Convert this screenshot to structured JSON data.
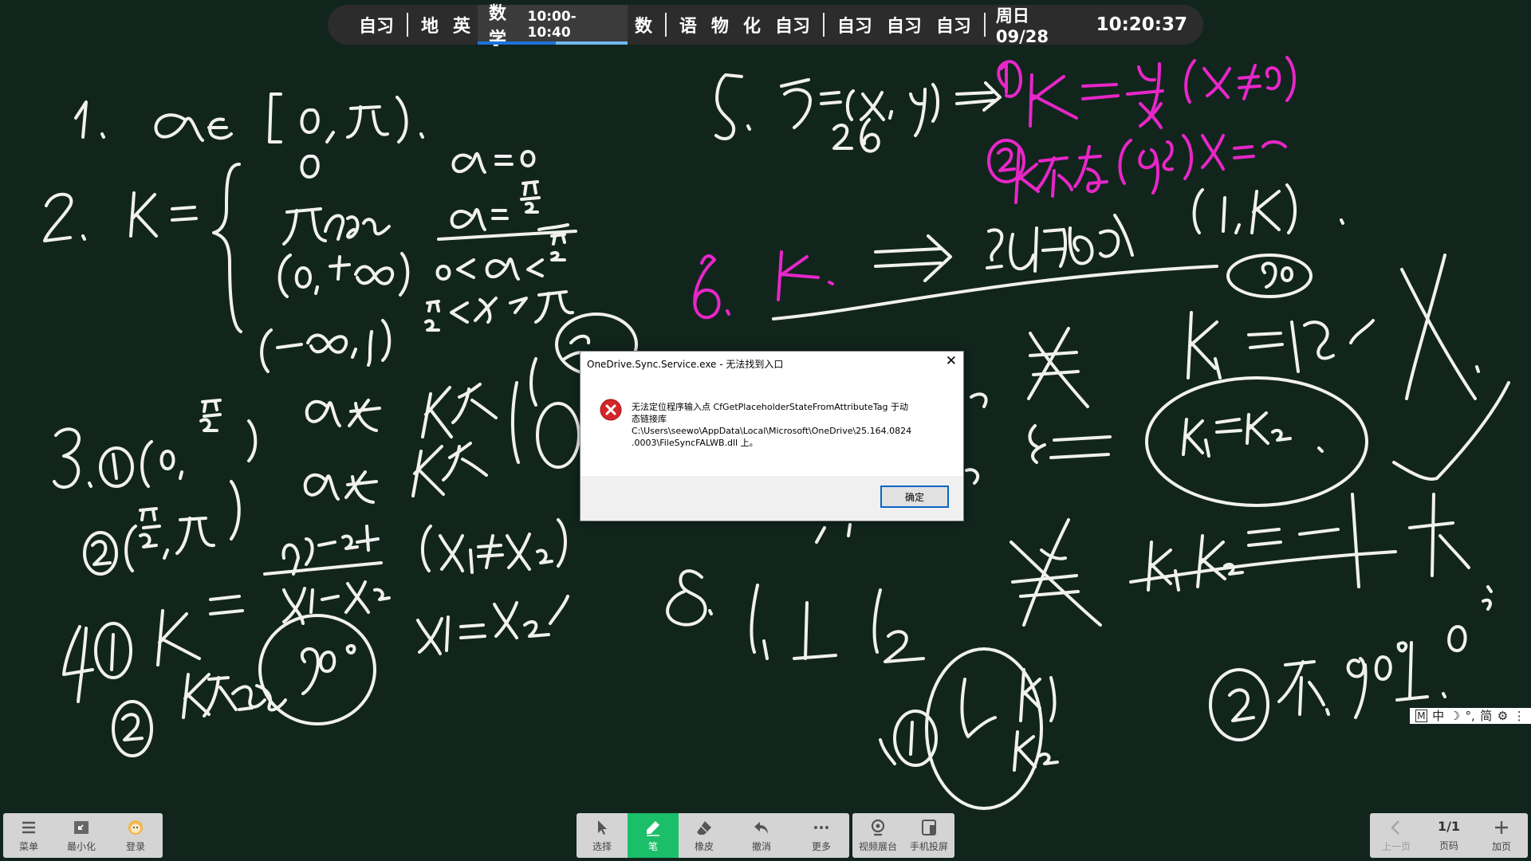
{
  "schedule": {
    "groups": [
      [
        "自习"
      ],
      [
        "地",
        "英"
      ],
      [
        "数"
      ],
      [
        "语",
        "物",
        "化",
        "自习"
      ],
      [
        "自习",
        "自习",
        "自习"
      ]
    ],
    "current": {
      "subject": "数学",
      "time": "10:00-10:40"
    },
    "date": "周日 09/28",
    "clock": "10:20:37"
  },
  "dialog": {
    "title": "OneDrive.Sync.Service.exe - 无法找到入口",
    "message_lines": [
      "无法定位程序输入点 CfGetPlaceholderStateFromAttributeTag 于动",
      "态链接库",
      "C:\\Users\\seewo\\AppData\\Local\\Microsoft\\OneDrive\\25.164.0824",
      ".0003\\FileSyncFALWB.dll 上。"
    ],
    "ok_label": "确定",
    "close_glyph": "✕"
  },
  "ime": {
    "items": [
      "M",
      "中",
      "☽",
      "°,",
      "简",
      "⚙",
      "⋮"
    ]
  },
  "toolbar_left": {
    "menu_label": "菜单",
    "minimize_label": "最小化",
    "login_label": "登录"
  },
  "toolbar_center": {
    "select_label": "选择",
    "pen_label": "笔",
    "eraser_label": "橡皮",
    "undo_label": "撤消",
    "more_label": "更多"
  },
  "toolbar_media": {
    "visualizer_label": "视频展台",
    "cast_label": "手机投屏"
  },
  "toolbar_right": {
    "prev_label": "上一页",
    "page_value": "1/1",
    "page_label": "页码",
    "add_label": "加页"
  },
  "colors": {
    "board": "#11251d",
    "ink_white": "#f1f1ef",
    "ink_magenta": "#e826c8",
    "pen_active": "#1bbf6a",
    "topbar": "#2c2c2c",
    "progress_blue": "#1e73d9"
  }
}
